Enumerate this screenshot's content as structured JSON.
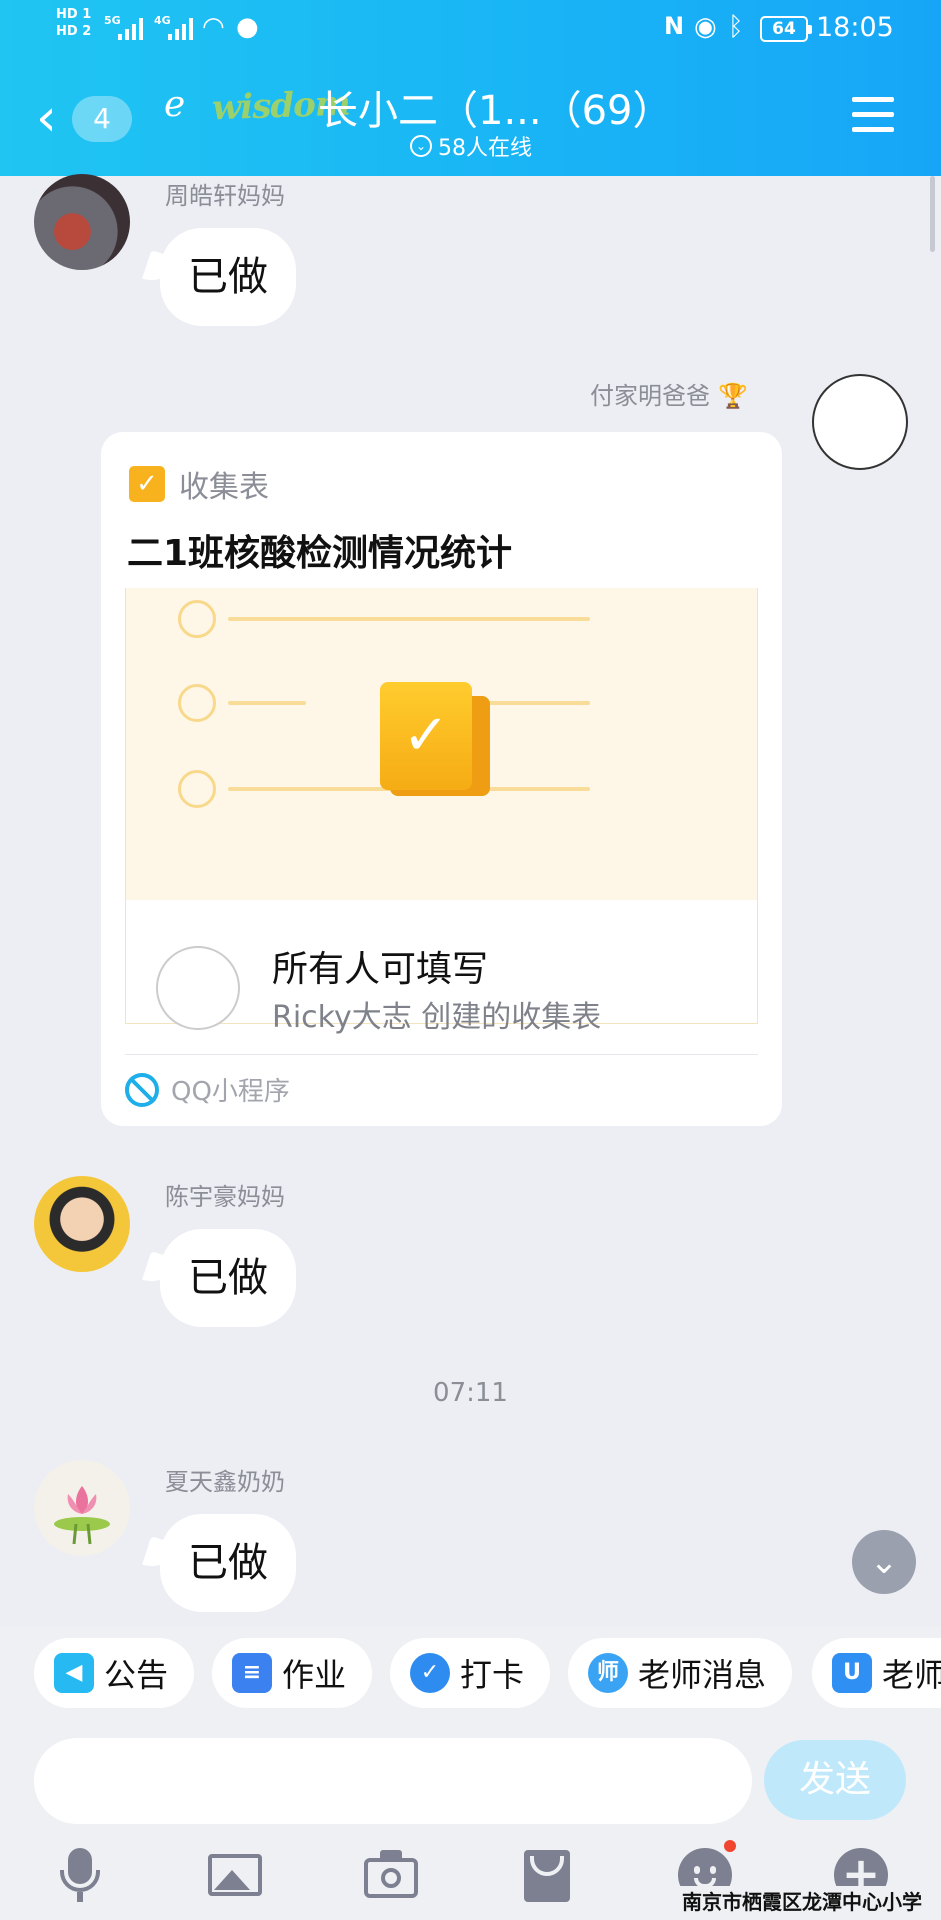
{
  "status_bar": {
    "hd1": "HD 1",
    "hd2": "HD 2",
    "net1": "5G",
    "net2": "4G",
    "battery": "64",
    "time": "18:05"
  },
  "header": {
    "back_badge": "4",
    "group_title": "长小二（1...（69）",
    "online_count": "58人在线"
  },
  "messages": [
    {
      "sender": "周皓轩妈妈",
      "text": "已做"
    },
    {
      "sender": "付家明爸爸",
      "type": "form_card"
    },
    {
      "sender": "陈宇豪妈妈",
      "text": "已做"
    },
    {
      "sender": "夏天鑫奶奶",
      "text": "已做"
    }
  ],
  "card": {
    "category": "收集表",
    "title": "二1班核酸检测情况统计",
    "permission": "所有人可填写",
    "creator_line": "Ricky大志 创建的收集表",
    "footer": "QQ小程序"
  },
  "timestamp": "07:11",
  "quick_actions": [
    {
      "label": "公告",
      "color": "#27b9f2"
    },
    {
      "label": "作业",
      "color": "#3b82f0"
    },
    {
      "label": "打卡",
      "color": "#2e8cf0"
    },
    {
      "label": "老师消息",
      "color": "#3aa3f3"
    },
    {
      "label": "老师",
      "color": "#2f8ff3"
    }
  ],
  "input": {
    "placeholder": "",
    "send_label": "发送"
  },
  "watermark": "南京市栖霞区龙潭中心小学",
  "colors": {
    "header_start": "#20c5f2",
    "header_end": "#17a6f7",
    "background": "#eceef3",
    "send_button": "#bfe9fb",
    "form_icon": "#f7b21d"
  }
}
